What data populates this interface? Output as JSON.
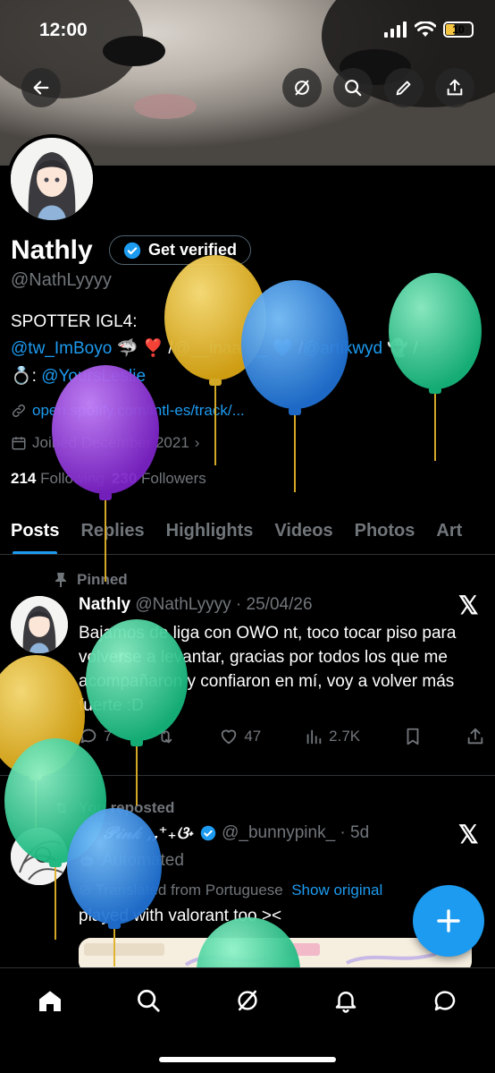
{
  "status": {
    "time": "12:00",
    "battery": "10"
  },
  "profile": {
    "name": "Nathly",
    "verify_label": "Get verified",
    "handle": "@NathLyyyy",
    "bio_line1": "SPOTTER IGL4:",
    "bio_mention1": "@tw_ImBoyo",
    "bio_emojis1": " 🦈 ❣️ /",
    "bio_mention2": "@__inaasy_",
    "bio_emojis2": " 💙 /",
    "bio_mention3": "@artikwyd",
    "bio_emojis3": " 👻 /",
    "bio_ring": "💍: ",
    "bio_mention4": "@YoursLeslie",
    "link": "open.spotify.com/intl-es/track/...",
    "joined": "Joined December 2021",
    "following_count": "214",
    "following_label": "Following",
    "followers_count": "230",
    "followers_label": "Followers"
  },
  "tabs": [
    "Posts",
    "Replies",
    "Highlights",
    "Videos",
    "Photos",
    "Art"
  ],
  "post1": {
    "pinned_label": "Pinned",
    "name": "Nathly",
    "handle": "@NathLyyyy",
    "sep": " · ",
    "date": "25/04/26",
    "text": "Bajamos de liga con OWO nt, toco tocar piso para volverse a levantar, gracias por todos los que me acompañaron y confiaron en mí, voy a volver más fuerte :D",
    "replies": "7",
    "likes": "47",
    "views": "2.7K"
  },
  "post2": {
    "repost_label": "You reposted",
    "name": "𝒮. 𝒫𝒾𝓃𝓀 ,,⁺₊ଓ˖",
    "handle": "@_bunnypink_",
    "sep": " · ",
    "date": "5d",
    "automated": "Automated",
    "translated": "Translated from Portuguese",
    "show_original": "Show original",
    "text": "played with valorant too ><"
  },
  "icons": {
    "back": "back-arrow-icon",
    "grok": "grok-icon",
    "search": "search-icon",
    "edit": "pencil-icon",
    "share": "share-icon",
    "nav": [
      "home-icon",
      "search-icon",
      "grok-icon",
      "bell-icon",
      "messages-icon"
    ]
  },
  "colors": {
    "accent": "#1d9bf0",
    "balloon_yellow": "#f2c12e",
    "balloon_blue": "#2f8fe0",
    "balloon_green": "#2fd39a",
    "balloon_purple": "#9b3ee0"
  }
}
